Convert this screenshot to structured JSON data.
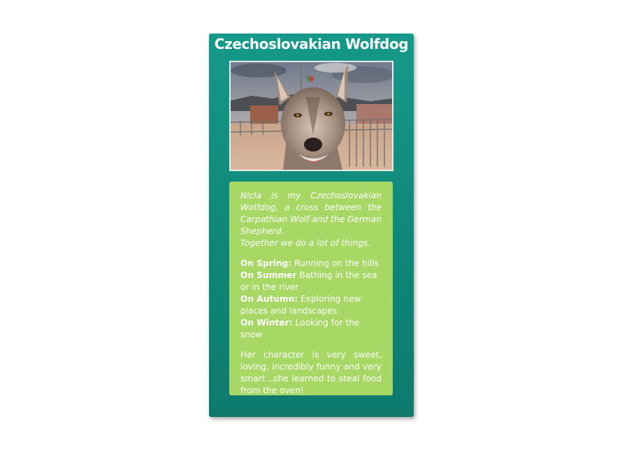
{
  "card": {
    "title": "Czechoslovakian Wolfdog"
  },
  "photo": {
    "description_icon": "dog-photo"
  },
  "panel": {
    "intro_line1": "Nicla is my Czechoslovakian Wolfdog, a cross between the Carpathian Wolf and the German Shepherd.",
    "intro_line2": "Together we do a lot of things.",
    "seasons": [
      {
        "label": "On Spring:",
        "text": " Running on the hills"
      },
      {
        "label": "On Summer",
        "text": " Bathing in the sea or in the river"
      },
      {
        "label": "On Autumn:",
        "text": " Exploring new places and landscapes"
      },
      {
        "label": "On Winter:",
        "text": " Looking for the snow"
      }
    ],
    "character": "Her character is very sweet, loving, incredibly funny and very smart...she learned to steal food from the oven!"
  },
  "colors": {
    "card_top": "#16998a",
    "card_bottom": "#0d7a6c",
    "panel": "#a7d765"
  }
}
